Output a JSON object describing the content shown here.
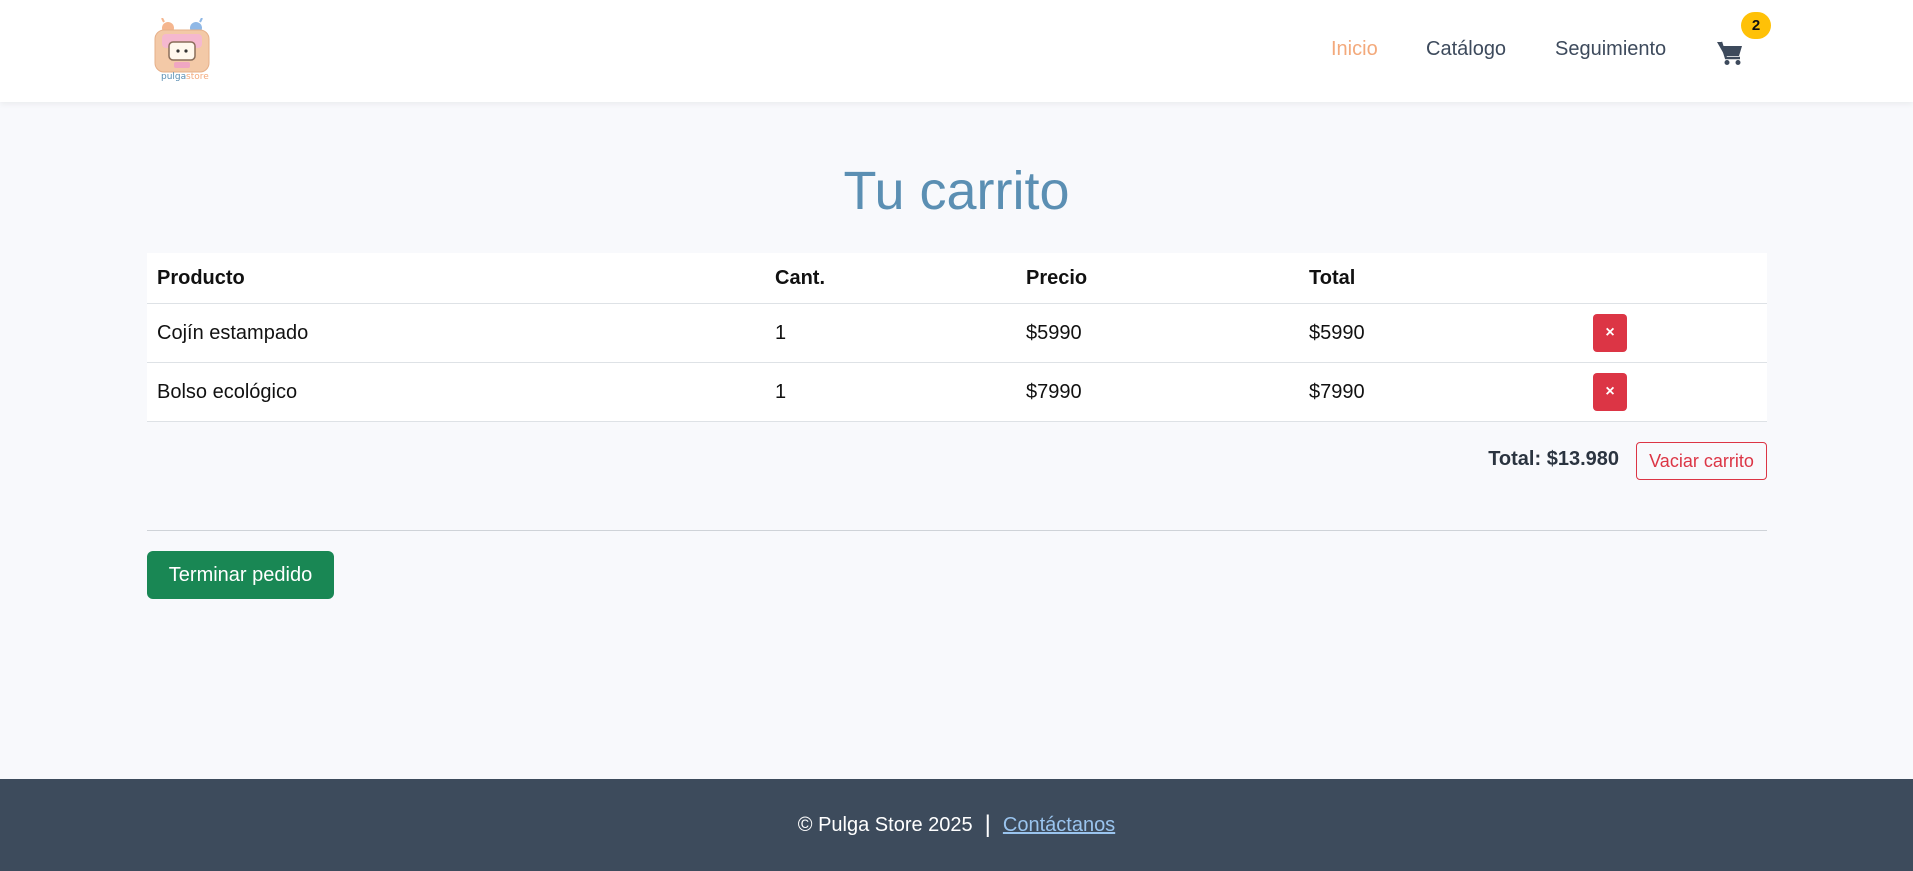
{
  "brand": {
    "logo_text_a": "pulga",
    "logo_text_b": "store"
  },
  "nav": {
    "items": [
      {
        "label": "Inicio",
        "active": true
      },
      {
        "label": "Catálogo",
        "active": false
      },
      {
        "label": "Seguimiento",
        "active": false
      }
    ],
    "cart_count": "2",
    "cart_icon": "shopping-cart-icon"
  },
  "main": {
    "title": "Tu carrito",
    "table": {
      "headers": [
        "Producto",
        "Cant.",
        "Precio",
        "Total"
      ],
      "rows": [
        {
          "product": "Cojín estampado",
          "qty": "1",
          "price": "$5990",
          "total": "$5990",
          "remove": "×"
        },
        {
          "product": "Bolso ecológico",
          "qty": "1",
          "price": "$7990",
          "total": "$7990",
          "remove": "×"
        }
      ]
    },
    "summary_total": "Total: $13.980",
    "empty_button": "Vaciar carrito",
    "checkout_button": "Terminar pedido"
  },
  "footer": {
    "copyright": "© Pulga Store 2025",
    "separator": "|",
    "contact_link": "Contáctanos"
  },
  "colors": {
    "accent": "#5b8fb3",
    "active_nav": "#f3a97b",
    "danger": "#dc3545",
    "success": "#198754",
    "badge": "#ffc107",
    "footer_bg": "#3d4b5c"
  }
}
